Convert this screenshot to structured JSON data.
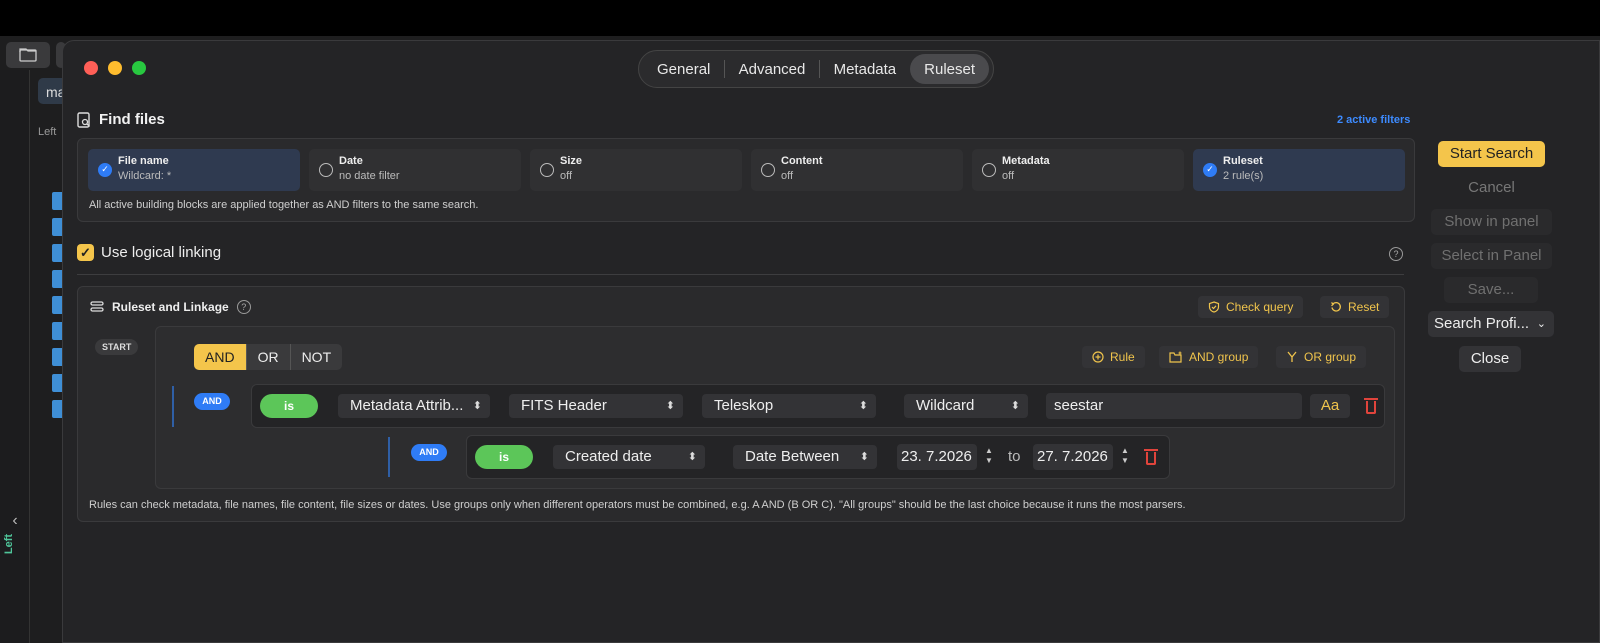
{
  "tabs": [
    {
      "label": "General",
      "active": false
    },
    {
      "label": "Advanced",
      "active": false
    },
    {
      "label": "Metadata",
      "active": false
    },
    {
      "label": "Ruleset",
      "active": true
    }
  ],
  "background": {
    "tab_label": "ma",
    "left_label": "Left",
    "left_panel_vertical_label": "Left"
  },
  "find_files": {
    "title": "Find files",
    "active_filters": "2 active filters"
  },
  "blocks": [
    {
      "title": "File name",
      "subtitle": "Wildcard: *",
      "checked": true
    },
    {
      "title": "Date",
      "subtitle": "no date filter",
      "checked": false
    },
    {
      "title": "Size",
      "subtitle": "off",
      "checked": false
    },
    {
      "title": "Content",
      "subtitle": "off",
      "checked": false
    },
    {
      "title": "Metadata",
      "subtitle": "off",
      "checked": false
    },
    {
      "title": "Ruleset",
      "subtitle": "2 rule(s)",
      "checked": true
    }
  ],
  "blocks_note": "All active building blocks are applied together as AND filters to the same search.",
  "logical_linking": {
    "label": "Use logical linking",
    "checked": true
  },
  "ruleset": {
    "title": "Ruleset and Linkage",
    "check_query": "Check query",
    "reset": "Reset",
    "start_badge": "START",
    "operators": [
      "AND",
      "OR",
      "NOT"
    ],
    "selected_operator": "AND",
    "add_rule": "Rule",
    "add_and_group": "AND group",
    "add_or_group": "OR group",
    "rule1": {
      "link": "AND",
      "is": "is",
      "field": "Metadata Attrib...",
      "source": "FITS Header",
      "attribute": "Teleskop",
      "mode": "Wildcard",
      "value": "seestar",
      "case_btn": "Aa"
    },
    "rule2": {
      "link": "AND",
      "is": "is",
      "field": "Created date",
      "mode": "Date Between",
      "from": "23.  7.2026",
      "to_label": "to",
      "to": "27.  7.2026"
    },
    "note": "Rules can check metadata, file names, file content, file sizes or dates. Use groups only when different operators must be combined, e.g. A AND (B OR C). \"All groups\" should be the last choice because it runs the most parsers."
  },
  "side": {
    "start_search": "Start Search",
    "cancel": "Cancel",
    "show_in_panel": "Show in panel",
    "select_in_panel": "Select in Panel",
    "save": "Save...",
    "search_profile": "Search Profi...",
    "close": "Close"
  },
  "colors": {
    "accent": "#f4c54b",
    "blue": "#2f7cf6",
    "green": "#5cc659",
    "danger": "#e0443c"
  }
}
